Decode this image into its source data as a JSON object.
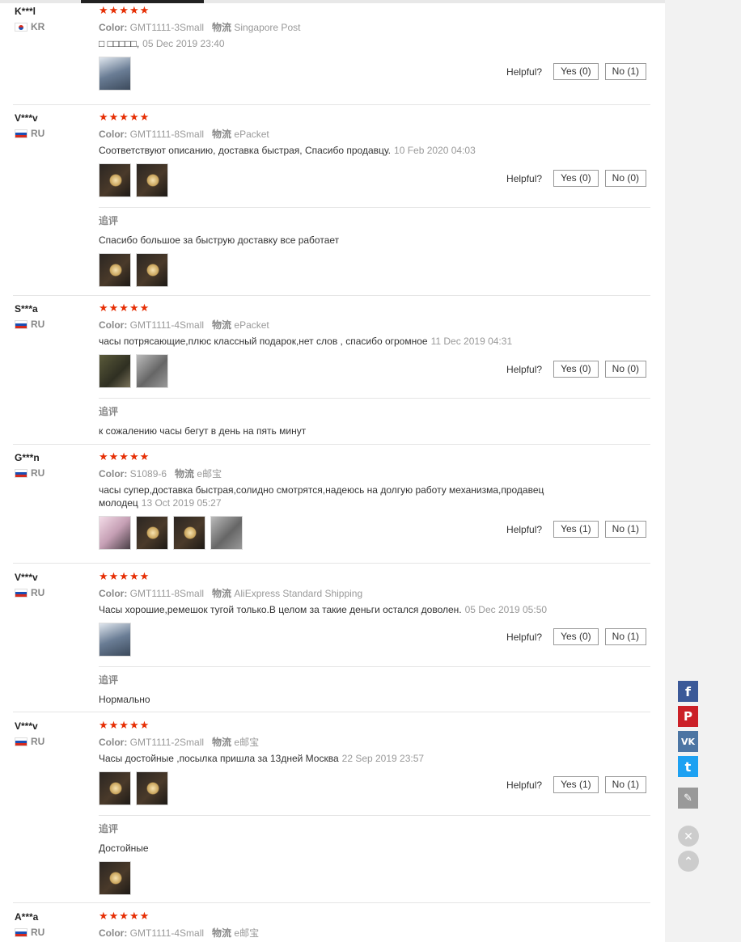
{
  "colors": {
    "star": "#e62e04",
    "facebook": "#3b5998",
    "pinterest": "#cb2027",
    "vk": "#4c75a3",
    "twitter": "#1da1f2",
    "edit": "#999999"
  },
  "helpful_label": "Helpful?",
  "append_title": "追评",
  "color_label": "Color:",
  "shipping_label": "物流",
  "reviews": [
    {
      "user": "K***l",
      "country": "KR",
      "stars": "★★★★★",
      "color": "GMT1111-3Small",
      "shipping": "Singapore Post",
      "text": "□ □□□□□,",
      "date": "05 Dec 2019 23:40",
      "yes": "Yes (0)",
      "no": "No (1)"
    },
    {
      "user": "V***v",
      "country": "RU",
      "stars": "★★★★★",
      "color": "GMT1111-8Small",
      "shipping": "ePacket",
      "text": "Соответствуют описанию, доставка быстрая, Спасибо продавцу.",
      "date": "10 Feb 2020 04:03",
      "yes": "Yes (0)",
      "no": "No (0)",
      "append": "Спасибо большое за быструю доставку все работает"
    },
    {
      "user": "S***a",
      "country": "RU",
      "stars": "★★★★★",
      "color": "GMT1111-4Small",
      "shipping": "ePacket",
      "text": "часы потрясающие,плюс классный подарок,нет слов , спасибо огромное",
      "date": "11 Dec 2019 04:31",
      "yes": "Yes (0)",
      "no": "No (0)",
      "append": "к сожалению часы бегут в день на пять минут"
    },
    {
      "user": "G***n",
      "country": "RU",
      "stars": "★★★★★",
      "color": "S1089-6",
      "shipping": "e邮宝",
      "text": "часы супер,доставка быстрая,солидно смотрятся,надеюсь на долгую работу механизма,продавец молодец",
      "date": "13 Oct 2019 05:27",
      "yes": "Yes (1)",
      "no": "No (1)"
    },
    {
      "user": "V***v",
      "country": "RU",
      "stars": "★★★★★",
      "color": "GMT1111-8Small",
      "shipping": "AliExpress Standard Shipping",
      "text": "Часы хорошие,ремешок тугой только.В целом за такие деньги остался доволен.",
      "date": "05 Dec 2019 05:50",
      "yes": "Yes (0)",
      "no": "No (1)",
      "append": "Нормально"
    },
    {
      "user": "V***v",
      "country": "RU",
      "stars": "★★★★★",
      "color": "GMT1111-2Small",
      "shipping": "e邮宝",
      "text": "Часы достойные ,посылка пришла за 13дней Москва",
      "date": "22 Sep 2019 23:57",
      "yes": "Yes (1)",
      "no": "No (1)",
      "append": "Достойные"
    },
    {
      "user": "A***a",
      "country": "RU",
      "stars": "★★★★★",
      "color": "GMT1111-4Small",
      "shipping": "e邮宝"
    }
  ],
  "share": {
    "facebook": "f",
    "pinterest": "P",
    "vk": "VK",
    "twitter": "t",
    "edit": "✎",
    "close": "✕",
    "up": "⌃"
  }
}
